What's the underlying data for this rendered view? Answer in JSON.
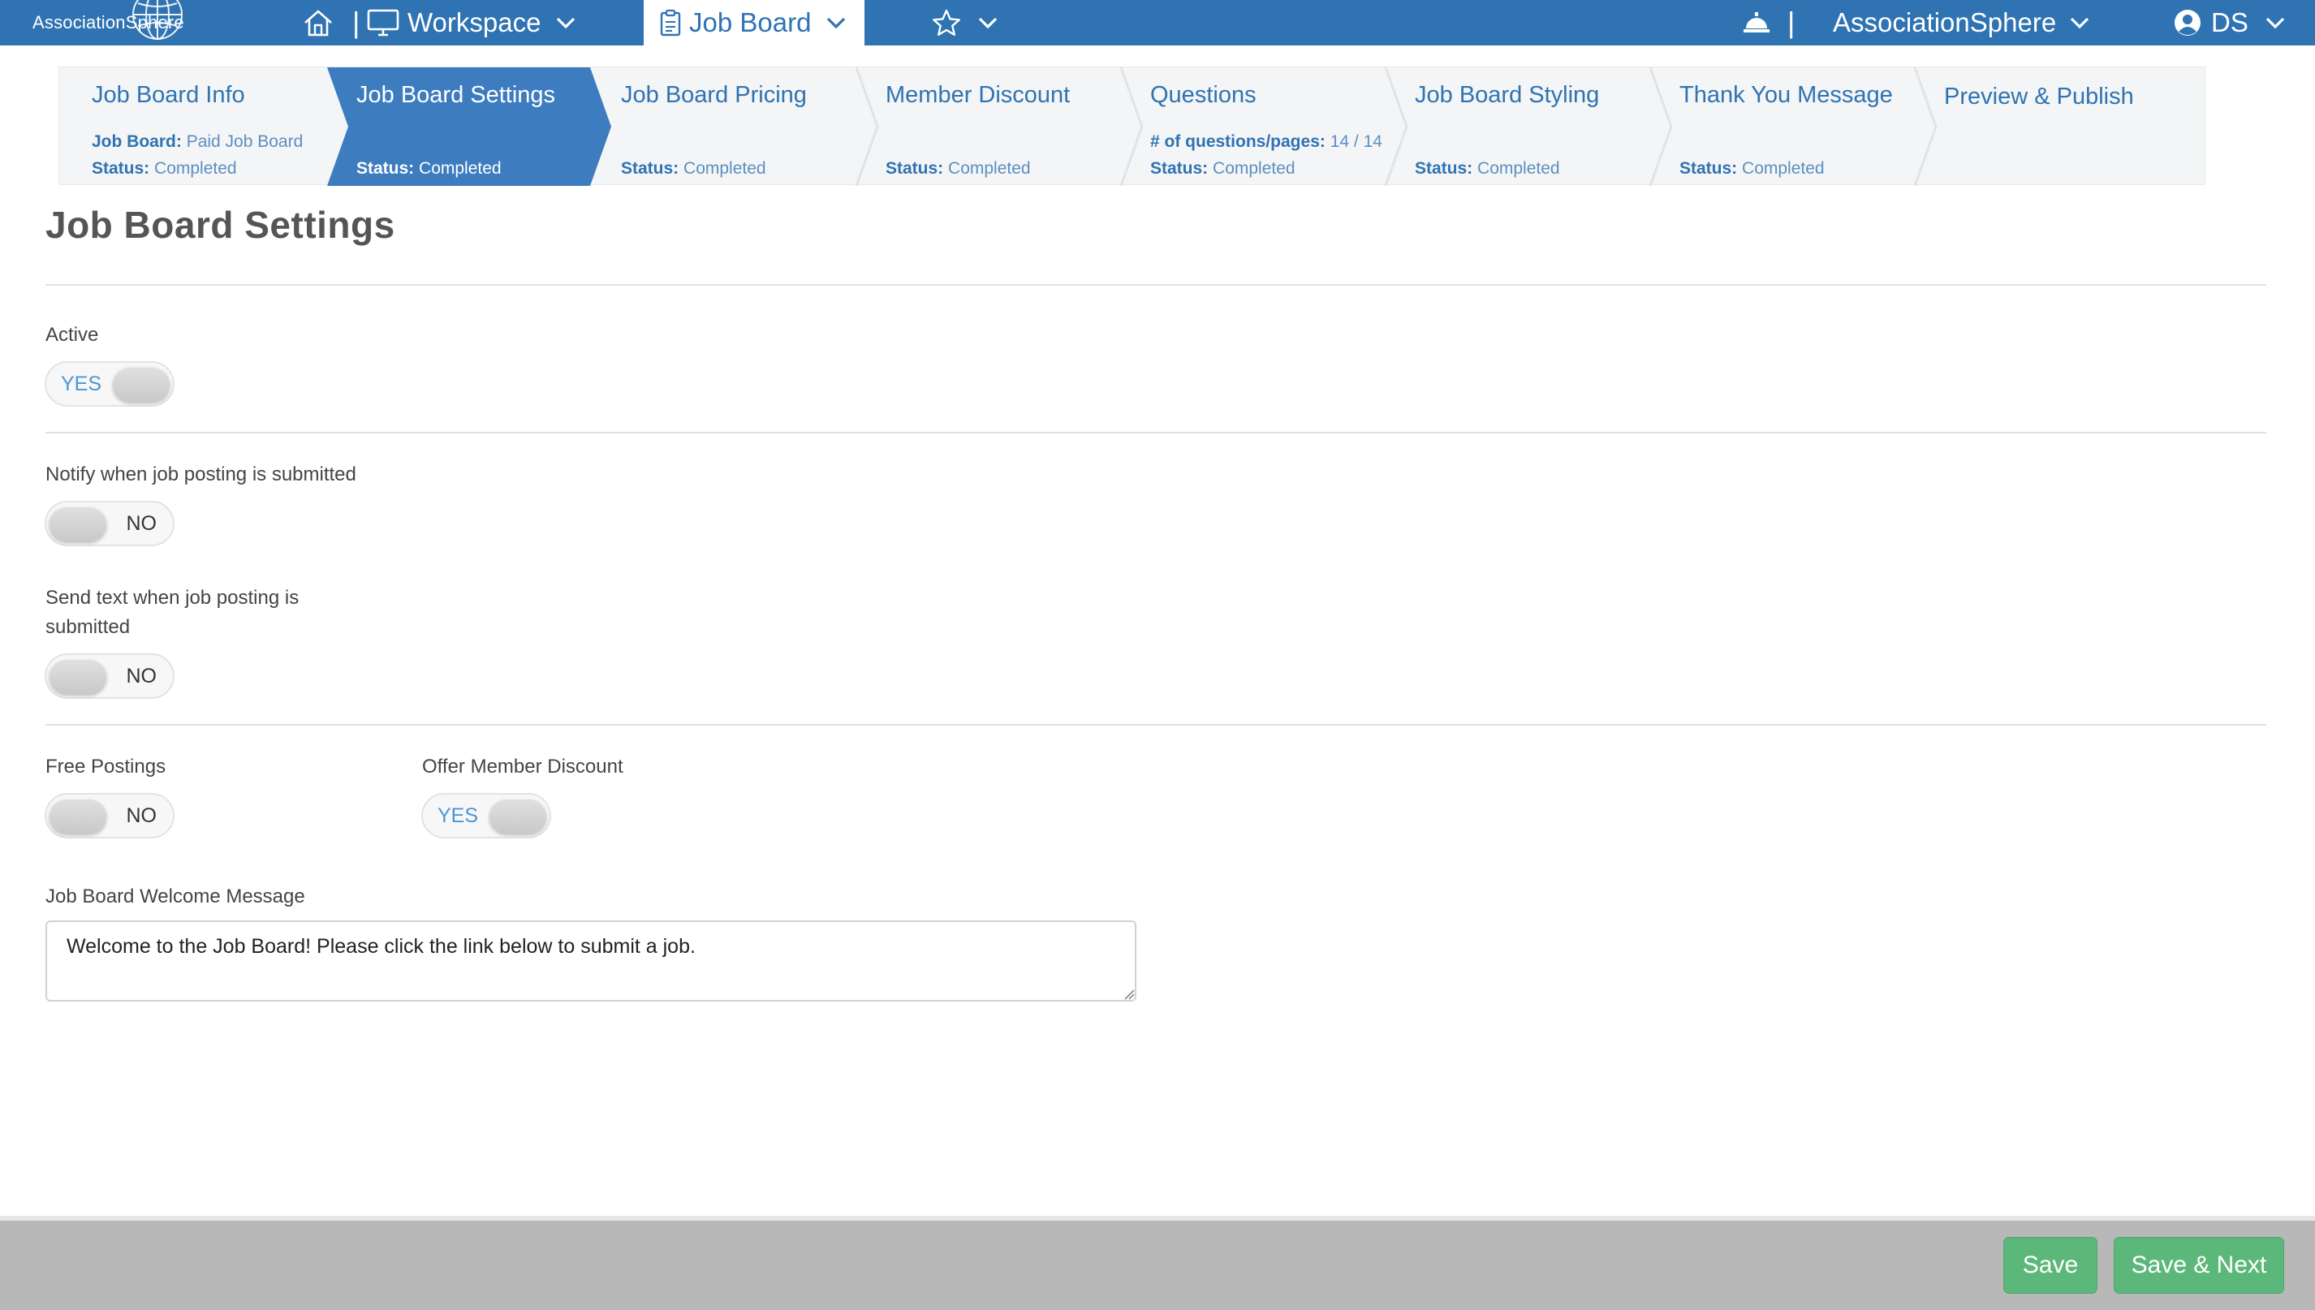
{
  "topnav": {
    "logo_text": "AssociationSphere",
    "separator": "|",
    "workspace_label": "Workspace",
    "active_module_label": "Job Board",
    "org_label": "AssociationSphere",
    "user_initials": "DS"
  },
  "wizard": {
    "steps": [
      {
        "title": "Job Board Info",
        "meta1_key": "Job Board:",
        "meta1_val": "Paid Job Board",
        "meta2_key": "Status:",
        "meta2_val": "Completed"
      },
      {
        "title": "Job Board Settings",
        "meta2_key": "Status:",
        "meta2_val": "Completed"
      },
      {
        "title": "Job Board Pricing",
        "meta2_key": "Status:",
        "meta2_val": "Completed"
      },
      {
        "title": "Member Discount",
        "meta2_key": "Status:",
        "meta2_val": "Completed"
      },
      {
        "title": "Questions",
        "meta1_key": "# of questions/pages:",
        "meta1_val": "14 / 14",
        "meta2_key": "Status:",
        "meta2_val": "Completed"
      },
      {
        "title": "Job Board Styling",
        "meta2_key": "Status:",
        "meta2_val": "Completed"
      },
      {
        "title": "Thank You Message",
        "meta2_key": "Status:",
        "meta2_val": "Completed"
      },
      {
        "title": "Preview & Publish"
      }
    ]
  },
  "page": {
    "title": "Job Board Settings"
  },
  "settings": {
    "active": {
      "label": "Active",
      "value": "YES"
    },
    "notify": {
      "label": "Notify when job posting is submitted",
      "value": "NO"
    },
    "send_text": {
      "label_line1": "Send text when job posting is",
      "label_line2": "submitted",
      "value": "NO"
    },
    "free_postings": {
      "label": "Free Postings",
      "value": "NO"
    },
    "member_discount": {
      "label": "Offer Member Discount",
      "value": "YES"
    },
    "welcome": {
      "label": "Job Board Welcome Message",
      "value": "Welcome to the Job Board! Please click the link below to submit a job."
    }
  },
  "footer": {
    "save_label": "Save",
    "save_next_label": "Save & Next"
  },
  "colors": {
    "brand_blue": "#2f73b2",
    "success_green": "#5cb87a",
    "toggle_on_text": "#4b97d6"
  }
}
